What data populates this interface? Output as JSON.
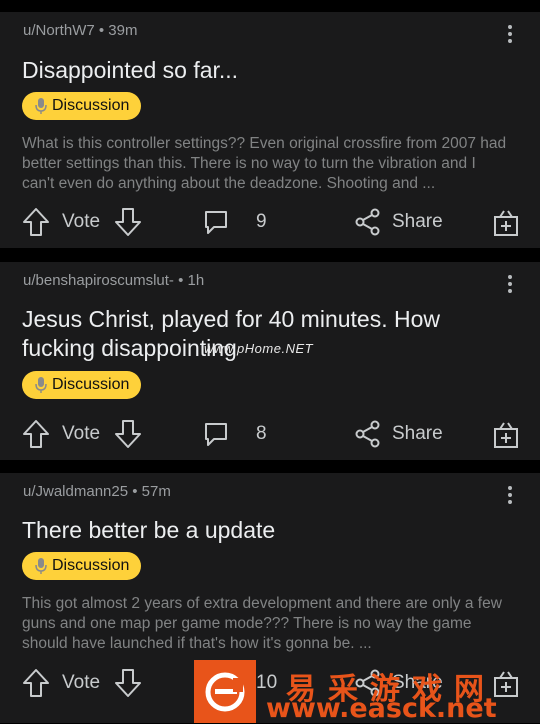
{
  "posts": [
    {
      "meta": "u/NorthW7 • 39m",
      "title": "Disappointed so far...",
      "flair": "Discussion",
      "snippet": "What is this controller settings?? Even original crossfire from 2007 had better settings than this. There is no way to turn the vibration and I can't even do anything about the deadzone. Shooting and ...",
      "vote_label": "Vote",
      "comments": "9",
      "share_label": "Share"
    },
    {
      "meta": "u/benshapiroscumslut- • 1h",
      "title": "Jesus Christ, played for 40 minutes. How fucking disappointing",
      "flair": "Discussion",
      "snippet": "",
      "vote_label": "Vote",
      "comments": "8",
      "share_label": "Share"
    },
    {
      "meta": "u/Jwaldmann25 • 57m",
      "title": "There better be a update",
      "flair": "Discussion",
      "snippet": "This got almost 2 years of extra development and there are only a few guns and one map per game mode??? There is no way the game should have launched if that's how it's gonna be. ...",
      "vote_label": "Vote",
      "comments": "10",
      "share_label": "Share"
    }
  ],
  "watermark": {
    "overlay_text": "www.pHome.NET",
    "banner_chinese": "易采游戏网",
    "banner_url": "www.easck.net"
  },
  "colors": {
    "background": "#000000",
    "card": "#1a1a1b",
    "flair": "#fed13a",
    "text": "#d7dadc",
    "muted": "#818384",
    "watermark": "#e8541a"
  },
  "icons": [
    "more-vert-icon",
    "microphone-icon",
    "upvote-arrow-icon",
    "downvote-arrow-icon",
    "comment-bubble-icon",
    "share-icon",
    "award-gift-icon"
  ]
}
